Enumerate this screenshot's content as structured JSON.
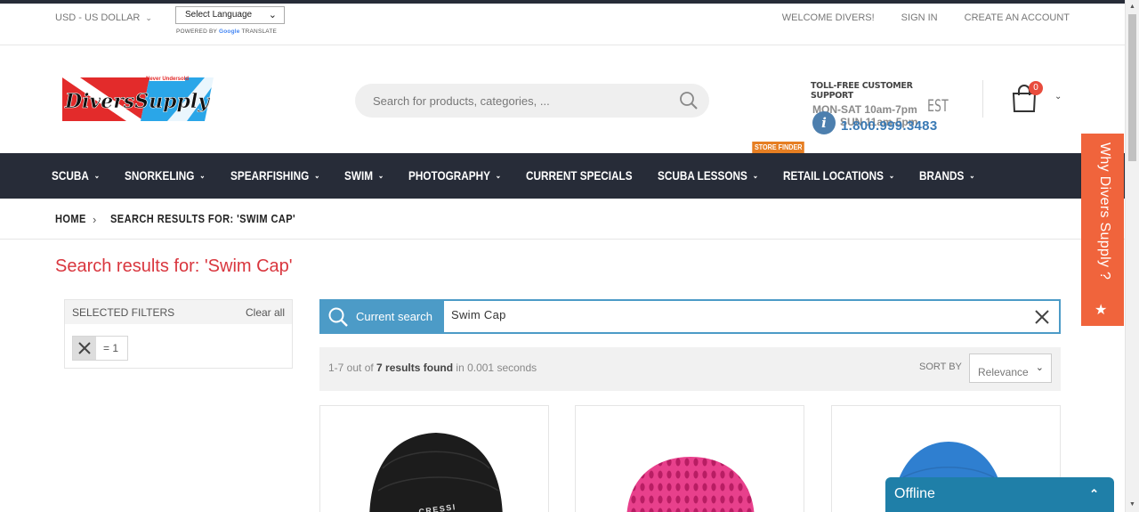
{
  "topbar": {
    "currency": "USD - US DOLLAR",
    "language_select": "Select Language",
    "powered_by": "POWERED BY",
    "google": "Google",
    "translate": "TRANSLATE",
    "welcome": "WELCOME DIVERS!",
    "sign_in": "SIGN IN",
    "create_account": "CREATE AN ACCOUNT"
  },
  "header": {
    "logo_text": "DiversSupply",
    "logo_tagline": "Never Undersold",
    "search_placeholder": "Search for products, categories, ...",
    "support_title": "TOLL-FREE CUSTOMER SUPPORT",
    "support_hours_1": "MON-SAT 10am-7pm",
    "support_hours_2": "SUN 11am-5pm",
    "support_tz": "EST",
    "support_phone": "1.800.999.3483",
    "cart_count": "0"
  },
  "nav": {
    "items": [
      {
        "label": "SCUBA",
        "chev": true
      },
      {
        "label": "SNORKELING",
        "chev": true
      },
      {
        "label": "SPEARFISHING",
        "chev": true
      },
      {
        "label": "SWIM",
        "chev": true
      },
      {
        "label": "PHOTOGRAPHY",
        "chev": true
      },
      {
        "label": "CURRENT SPECIALS",
        "chev": false
      },
      {
        "label": "SCUBA LESSONS",
        "chev": true
      },
      {
        "label": "RETAIL LOCATIONS",
        "chev": true
      },
      {
        "label": "BRANDS",
        "chev": true
      }
    ],
    "store_finder": "STORE FINDER"
  },
  "breadcrumb": {
    "home": "HOME",
    "current": "SEARCH RESULTS FOR: 'SWIM CAP'"
  },
  "page_title": "Search results for: 'Swim Cap'",
  "filters": {
    "title": "SELECTED FILTERS",
    "clear": "Clear all",
    "chip_value": "= 1"
  },
  "current_search": {
    "label": "Current search",
    "value": "Swim Cap"
  },
  "results": {
    "range": "1-7 out of",
    "count": "7 results found",
    "time": "in 0.001 seconds",
    "sort_label": "SORT BY",
    "sort_value": "Relevance"
  },
  "products": [
    {
      "brand": "CRESSI",
      "color": "#1c1c1c"
    },
    {
      "brand": "",
      "color": "#e8408c"
    },
    {
      "brand": "",
      "color": "#2f7fd0"
    }
  ],
  "why_tab": "Why Divers Supply ?",
  "chat": {
    "status": "Offline"
  },
  "colors": {
    "accent_red": "#d9363e",
    "nav_bg": "#272c38",
    "search_blue": "#4c9bc7",
    "why_orange": "#f0643c",
    "chat_blue": "#1f7fa8"
  }
}
